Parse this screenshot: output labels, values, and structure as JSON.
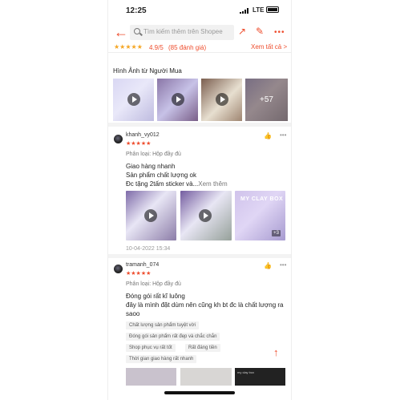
{
  "status_bar": {
    "time": "12:25",
    "network": "LTE"
  },
  "header": {
    "search_placeholder": "Tìm kiếm thêm trên Shopee",
    "icons": [
      "back-arrow-icon",
      "share-icon",
      "edit-icon",
      "more-icon"
    ]
  },
  "rating_summary": {
    "stars": "★★★★★",
    "score": "4.9/5",
    "count": "(85 đánh giá)",
    "see_all": "Xem tất cả >"
  },
  "buyer_photos": {
    "title": "Hình Ảnh từ Người Mua",
    "more_count": "+57"
  },
  "reviews": [
    {
      "username": "khanh_vy012",
      "stars": "★★★★★",
      "variant": "Phân loại: Hộp đầy đủ",
      "lines": [
        "Giao hàng nhanh",
        "Sản phẩm chất lượng ok",
        "Đc tặng 2tấm sticker và..."
      ],
      "see_more": "Xem thêm",
      "image_text": "MY CLAY BOX",
      "image_count": "+3",
      "timestamp": "10-04-2022 15:34"
    },
    {
      "username": "tramanh_074",
      "stars": "★★★★★",
      "variant": "Phân loại: Hộp đầy đủ",
      "lines": [
        "Đóng gói rất kĩ luông",
        "đây là mình đặt dùm nên cũng kh bt đc là chất lượng ra",
        "saoo"
      ],
      "tags": [
        "Chất lượng sản phẩm tuyệt vời",
        "Đóng gói sản phẩm rất đẹp và chắc chắn",
        "Shop phục vụ rất tốt",
        "Rất đáng tiền",
        "Thời gian giao hàng rất nhanh"
      ],
      "bottom_image_text": "my clay box"
    }
  ],
  "colors": {
    "accent": "#ee4d2d",
    "star": "#ee4d2d",
    "rating_star": "#f5a623",
    "muted": "#999999"
  }
}
